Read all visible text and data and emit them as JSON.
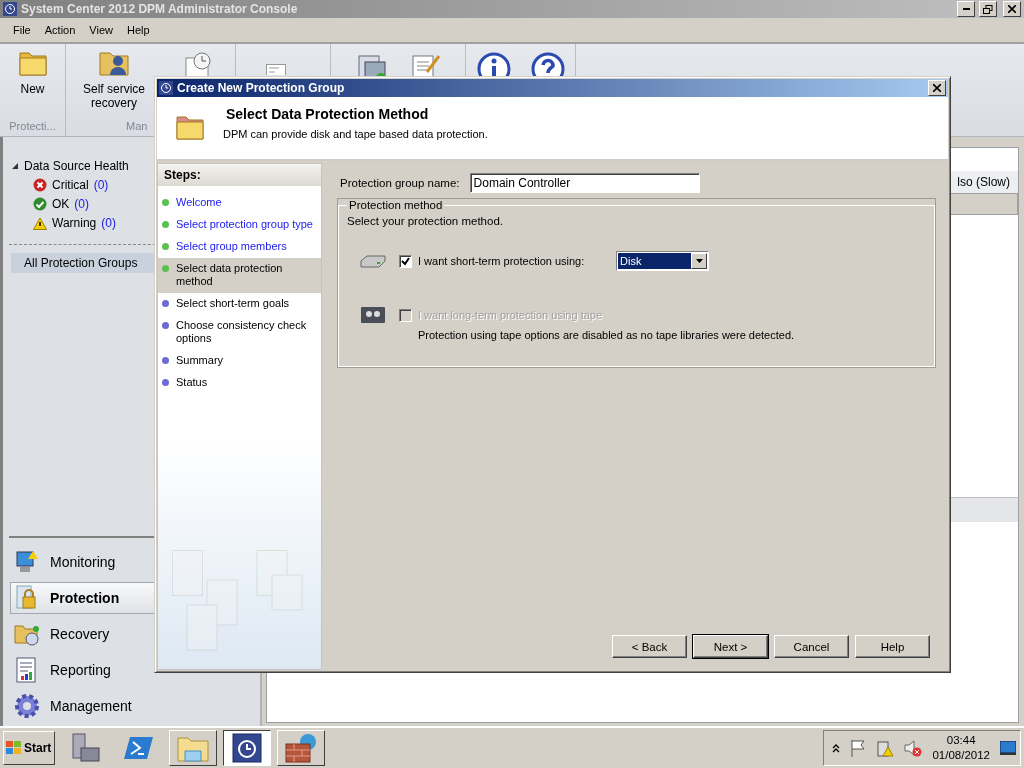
{
  "window": {
    "title": "System Center 2012 DPM Administrator Console"
  },
  "menu": [
    "File",
    "Action",
    "View",
    "Help"
  ],
  "ribbon": {
    "groups": [
      {
        "label": "Protecti...",
        "buttons": [
          {
            "label": "New"
          }
        ]
      },
      {
        "label": "Man",
        "buttons": [
          {
            "label": "Self service recovery"
          }
        ]
      }
    ]
  },
  "navigation": {
    "tree": {
      "label": "Data Source Health",
      "expanded": true,
      "children": [
        {
          "label": "Critical",
          "count": "(0)",
          "kind": "critical"
        },
        {
          "label": "OK",
          "count": "(0)",
          "kind": "ok"
        },
        {
          "label": "Warning",
          "count": "(0)",
          "kind": "warning"
        }
      ]
    },
    "groups": [
      {
        "label": "All Protection Groups",
        "selected": true
      }
    ],
    "workspaces": [
      {
        "label": "Monitoring",
        "kind": "monitoring",
        "selected": false
      },
      {
        "label": "Protection",
        "kind": "protection",
        "selected": true
      },
      {
        "label": "Recovery",
        "kind": "recovery",
        "selected": false
      },
      {
        "label": "Reporting",
        "kind": "reporting",
        "selected": false
      },
      {
        "label": "Management",
        "kind": "management",
        "selected": false
      }
    ]
  },
  "content": {
    "column_header": "lso (Slow)"
  },
  "dialog": {
    "title": "Create New Protection Group",
    "heading": "Select Data Protection Method",
    "subtitle": "DPM can provide disk and tape based data protection.",
    "steps_title": "Steps:",
    "steps": [
      {
        "label": "Welcome",
        "completed": true,
        "selected": false
      },
      {
        "label": "Select protection group type",
        "completed": true,
        "selected": false
      },
      {
        "label": "Select group members",
        "completed": true,
        "selected": false
      },
      {
        "label": "Select data protection method",
        "completed": false,
        "selected": true
      },
      {
        "label": "Select short-term goals",
        "completed": false,
        "selected": false
      },
      {
        "label": "Choose consistency check options",
        "completed": false,
        "selected": false
      },
      {
        "label": "Summary",
        "completed": false,
        "selected": false
      },
      {
        "label": "Status",
        "completed": false,
        "selected": false
      }
    ],
    "name_label": "Protection group name:",
    "name_value": "Domain Controller",
    "method": {
      "title": "Protection method",
      "instruction": "Select your protection method.",
      "options": [
        {
          "kind": "disk",
          "label": "I want short-term protection using:",
          "checked": true,
          "disabled": false,
          "dropdown": "Disk"
        },
        {
          "kind": "tape",
          "label": "I want long-term protection using tape",
          "checked": false,
          "disabled": true,
          "note": "Protection using tape options are disabled as no tape libraries were detected."
        }
      ]
    },
    "buttons": [
      {
        "label": "< Back",
        "default": false
      },
      {
        "label": "Next >",
        "default": true
      },
      {
        "label": "Cancel",
        "default": false
      },
      {
        "label": "Help",
        "default": false
      }
    ]
  },
  "taskbar": {
    "start": "Start",
    "apps": [
      {
        "kind": "server",
        "running": false,
        "selected": false
      },
      {
        "kind": "shell",
        "running": false,
        "selected": false
      },
      {
        "kind": "explorer",
        "running": true,
        "selected": false
      },
      {
        "kind": "dpm",
        "running": true,
        "selected": true
      },
      {
        "kind": "firewall",
        "running": true,
        "selected": false
      }
    ],
    "time": "03:44",
    "date": "01/08/2012"
  }
}
